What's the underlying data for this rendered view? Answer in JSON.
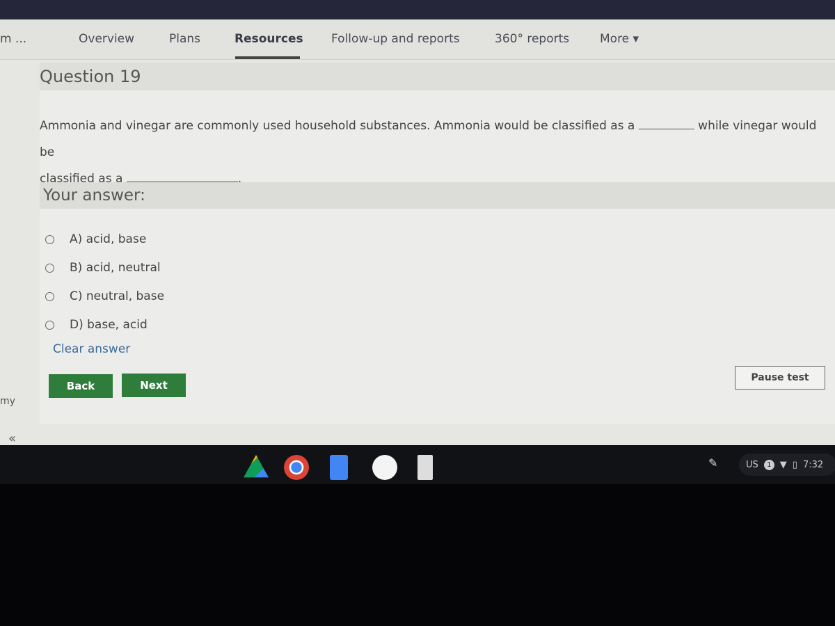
{
  "nav": {
    "truncated": "m ...",
    "tabs": [
      "Overview",
      "Plans",
      "Resources",
      "Follow-up and reports",
      "360° reports",
      "More ▾"
    ],
    "active": "Resources"
  },
  "question": {
    "title": "Question 19",
    "text_part1": "Ammonia and vinegar are commonly used household substances. Ammonia would be classified as a",
    "text_part2": "while vinegar would be",
    "text_part3": "classified as a",
    "text_end": "."
  },
  "answer": {
    "label": "Your answer:",
    "options": [
      "A) acid, base",
      "B) acid, neutral",
      "C) neutral, base",
      "D) base, acid"
    ],
    "clear": "Clear answer"
  },
  "buttons": {
    "back": "Back",
    "next": "Next",
    "pause": "Pause test"
  },
  "sidebar": {
    "text": "my",
    "collapse": "«"
  },
  "shelf": {
    "apps": [
      "google-drive-icon",
      "chrome-icon",
      "google-docs-icon",
      "play-store-icon",
      "calculator-icon"
    ],
    "locale": "US",
    "notifications": "1",
    "time": "7:32"
  },
  "colors": {
    "button_green": "#2e7d3a",
    "link": "#3d6a9c"
  }
}
